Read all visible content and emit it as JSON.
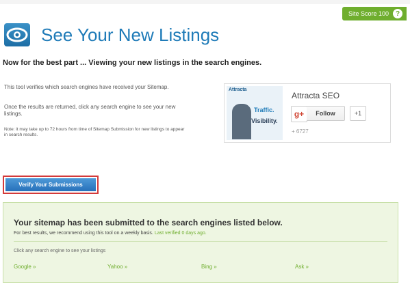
{
  "header": {
    "site_score": "Site Score 100",
    "help": "?",
    "title": "See Your New Listings",
    "subtitle": "Now for the best part ... Viewing your new listings in the search engines."
  },
  "description": {
    "p1": "This tool verifies which search engines have received your Sitemap.",
    "p2": "Once the results are returned, click any search engine to see your new listings.",
    "note": "Note: it may take up to 72 hours from time of Sitemap Submission for new listings to appear in search results."
  },
  "gplus_card": {
    "brand": "Attracta",
    "thumb_line1": "Traffic.",
    "thumb_line2": "Visibility.",
    "name": "Attracta SEO",
    "gplus_icon": "g+",
    "follow": "Follow",
    "plus_one": "+1",
    "count": "+ 6727"
  },
  "verify_button": "Verify Your Submissions",
  "results": {
    "title": "Your sitemap has been submitted to the search engines listed below.",
    "sub": "For best results, we recommend using this tool on a weekly basis.",
    "last_verified": "Last verified 0 days ago.",
    "click_prompt": "Click any search engine to see your listings",
    "engines": [
      "Google »",
      "Yahoo »",
      "Bing »",
      "Ask »"
    ]
  },
  "colors": {
    "accent_blue": "#1f7bb8",
    "accent_green": "#6fae2e",
    "highlight_red": "#d33a3a"
  }
}
